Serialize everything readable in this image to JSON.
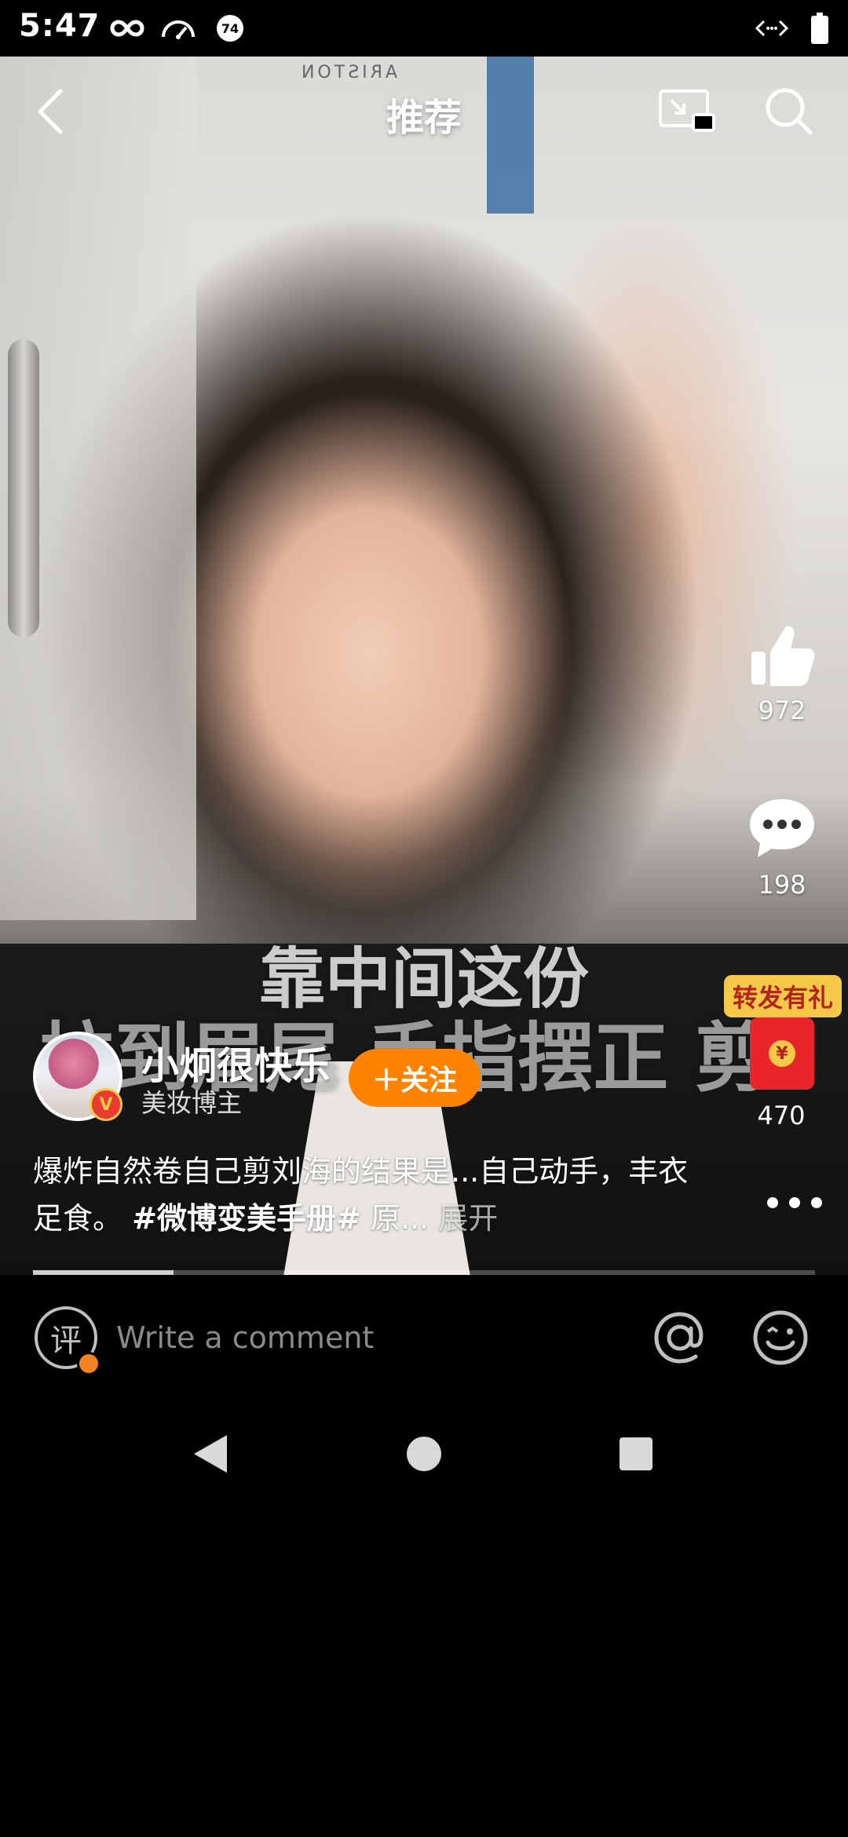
{
  "status_bar": {
    "time": "5:47",
    "icons": [
      "infinity-icon",
      "speedometer-icon",
      "notification-74-icon",
      "code-icon",
      "battery-icon"
    ],
    "badge_number": "74"
  },
  "video": {
    "watermark": "ARISTON",
    "subtitle_line1": "靠中间这份",
    "subtitle_line2": "拉到眉尾 手指摆正 剪"
  },
  "topbar": {
    "title": "推荐"
  },
  "rail": {
    "like_count": "972",
    "comment_count": "198",
    "gift_badge": "转发有礼",
    "share_count": "470",
    "coin_symbol": "¥"
  },
  "author": {
    "name": "小炯很快乐",
    "subtitle": "美妆博主",
    "vbadge": "V",
    "follow_label": "＋关注"
  },
  "caption": {
    "text": "爆炸自然卷自己剪刘海的结果是...自己动手，丰衣足食。",
    "hashtag": "#微博变美手册#",
    "trailing": " 原... ",
    "expand": "展开"
  },
  "progress": {
    "fraction": 0.18
  },
  "comment_bar": {
    "comment_icon_text": "评",
    "placeholder": "Write a comment"
  },
  "colors": {
    "accent": "#ff8200",
    "gift_yellow": "#f6c84a",
    "red": "#e8262a"
  }
}
